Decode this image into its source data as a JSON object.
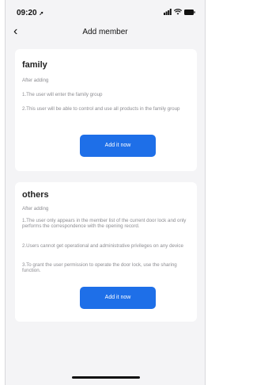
{
  "status": {
    "time": "09:20"
  },
  "nav": {
    "title": "Add member"
  },
  "family": {
    "title": "family",
    "subtitle": "After adding",
    "items": [
      "1.The user will enter the family group",
      "2.This user will be able to control and use all products in the family group"
    ],
    "button": "Add it now"
  },
  "others": {
    "title": "others",
    "subtitle": "After adding",
    "items": [
      "1.The user only appears in the member list of the current door lock and only performs the correspondence with the opening record.",
      "2.Users cannot get operational and administrative privileges on any device",
      "3.To grant the user permission to operate the door lock, use the sharing function."
    ],
    "button": "Add it now"
  },
  "colors": {
    "accent": "#1e6fe8",
    "background": "#f4f4f6",
    "card": "#ffffff",
    "muted_text": "#8d8d92"
  }
}
